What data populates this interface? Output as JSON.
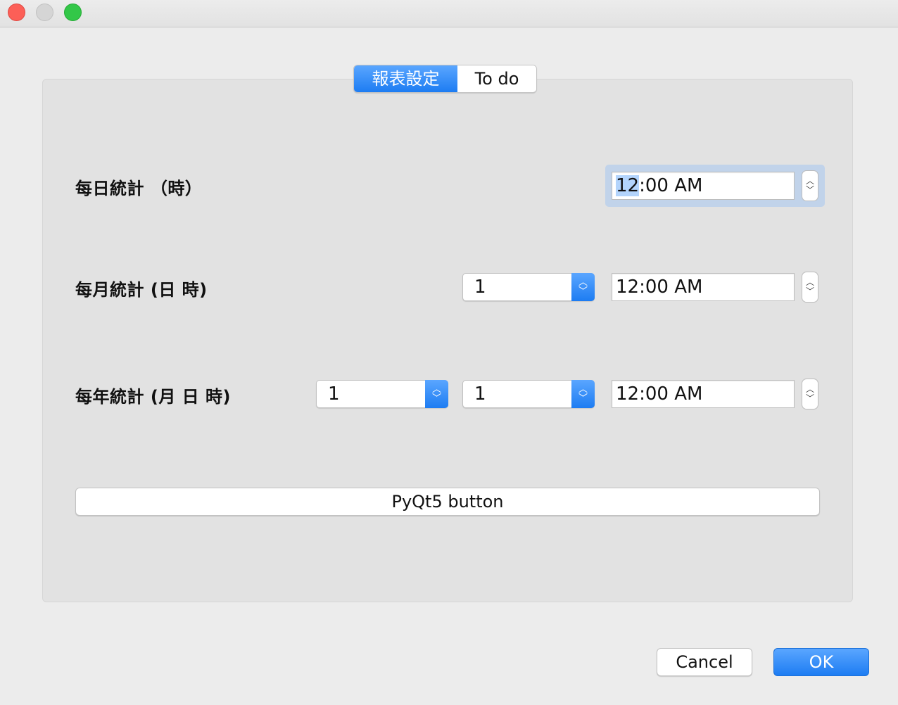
{
  "window": {
    "controls": [
      "close",
      "minimize",
      "maximize"
    ]
  },
  "tabs": [
    {
      "label": "報表設定",
      "active": true
    },
    {
      "label": "To do",
      "active": false
    }
  ],
  "rows": {
    "daily": {
      "label": "每日統計 （時）",
      "time_hour": "12",
      "time_rest": ":00 AM"
    },
    "monthly": {
      "label": "每月統計 (日 時)",
      "day": "1",
      "time": "12:00 AM"
    },
    "yearly": {
      "label": "每年統計 (月 日 時)",
      "month": "1",
      "day": "1",
      "time": "12:00 AM"
    }
  },
  "pyqt_button": "PyQt5 button",
  "dialog_buttons": {
    "cancel": "Cancel",
    "ok": "OK"
  },
  "colors": {
    "accent": "#1d7cf2",
    "close": "#fc5f57",
    "minimize": "#d5d5d5",
    "maximize": "#33c748"
  }
}
